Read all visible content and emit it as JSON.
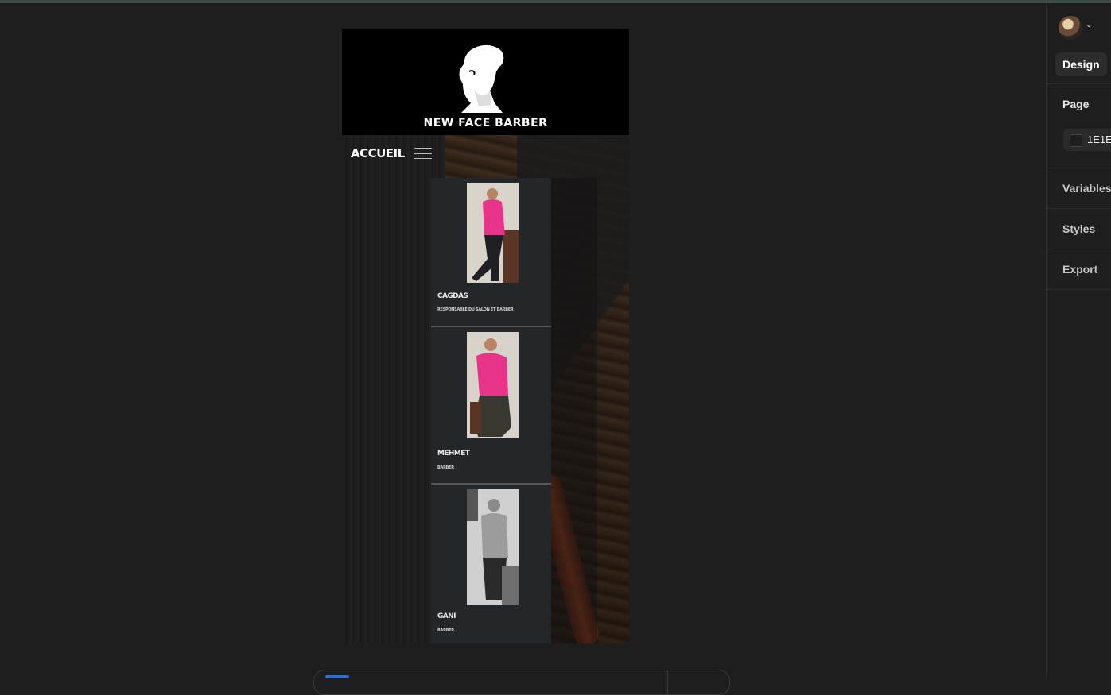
{
  "site": {
    "brand": "NEW FACE BARBER",
    "nav_label": "ACCUEIL",
    "team": [
      {
        "name": "CAGDAS",
        "role": "RESPONSABLE DU SALON ET BARBER",
        "photo": "barber-pink-shirt-seated"
      },
      {
        "name": "MEHMET",
        "role": "BARBER",
        "photo": "barber-pink-shirt-standing"
      },
      {
        "name": "GANI",
        "role": "BARBER",
        "photo": "barber-grey-shirt-bw"
      }
    ]
  },
  "panel": {
    "design_tab": "Design",
    "page_label": "Page",
    "page_color": "1E1E",
    "variables": "Variables",
    "styles": "Styles",
    "export": "Export"
  },
  "colors": {
    "canvas_bg": "#1e1e1e",
    "card_bg": "#23272a",
    "shirt_pink": "#e8338a"
  },
  "icons": [
    "logo-bearded-man",
    "hamburger-menu-icon",
    "chevron-down-icon",
    "user-avatar"
  ]
}
